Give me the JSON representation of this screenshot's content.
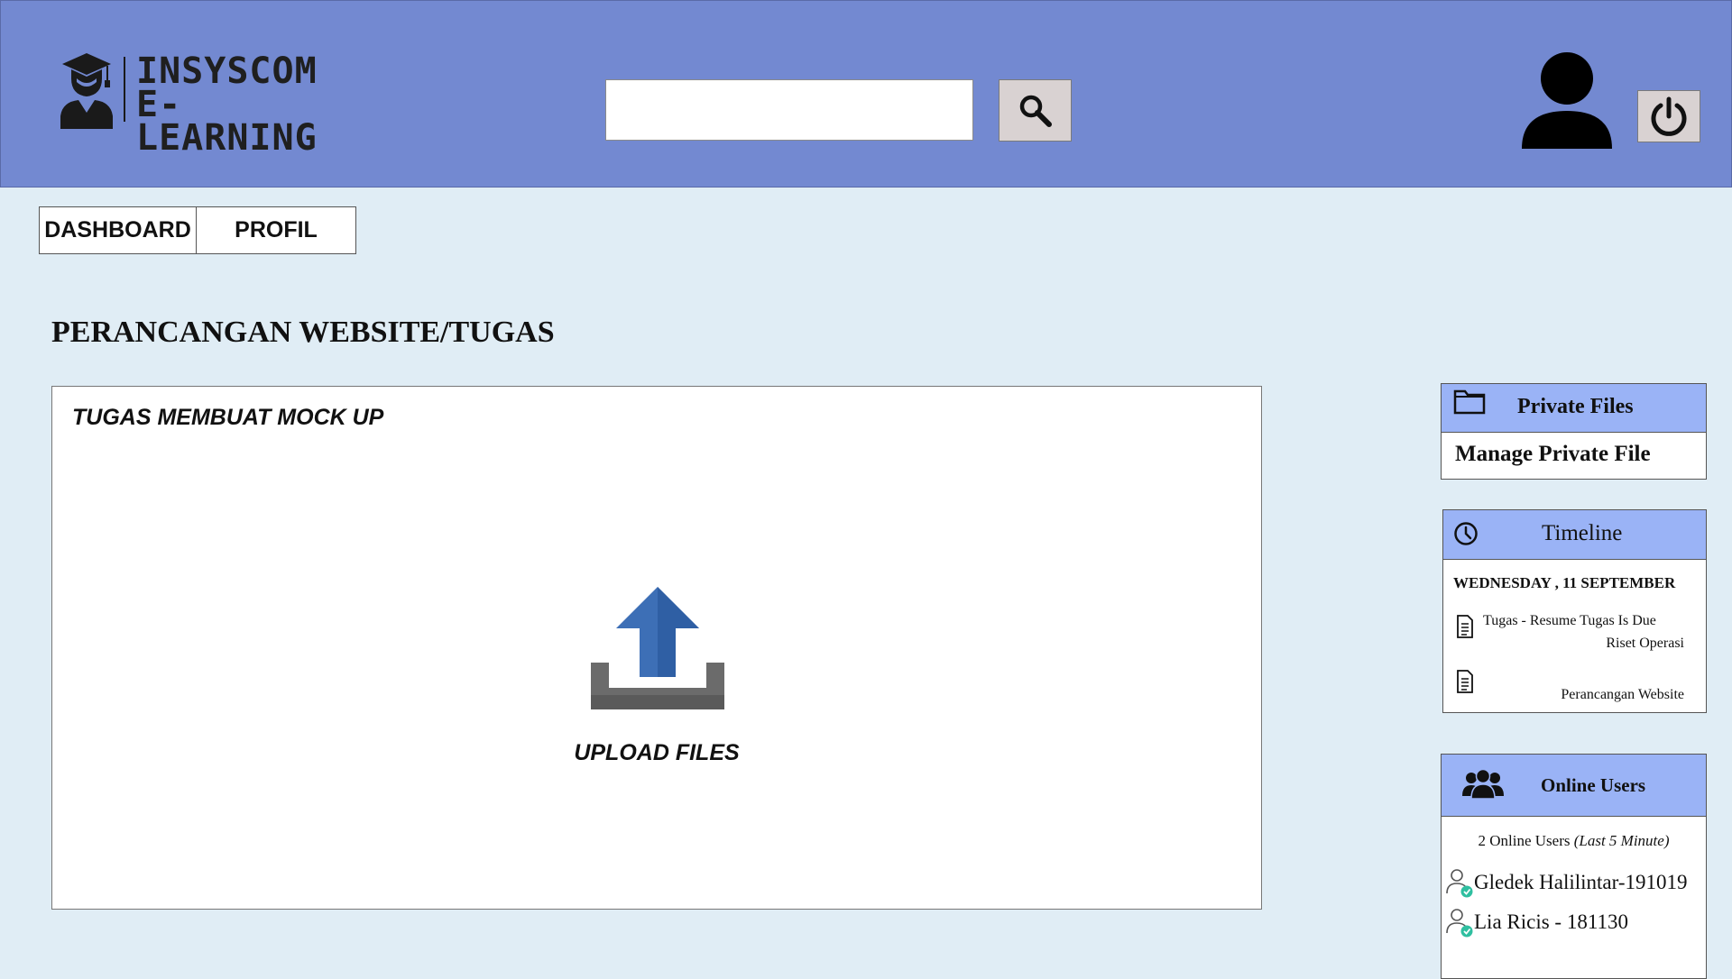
{
  "header": {
    "logo_line1": "INSYSCOM",
    "logo_line2": "E-LEARNING",
    "search_value": "",
    "search_icon": "search-icon",
    "avatar_icon": "user-avatar-icon",
    "power_icon": "power-icon"
  },
  "nav": {
    "dashboard": "DASHBOARD",
    "profil": "PROFIL"
  },
  "page": {
    "title": "PERANCANGAN WEBSITE/TUGAS"
  },
  "main": {
    "card_title": "TUGAS MEMBUAT MOCK UP",
    "upload_label": "UPLOAD FILES",
    "upload_icon": "upload-icon"
  },
  "private_files": {
    "title": "Private Files",
    "manage_link": "Manage Private File",
    "icon": "folder-icon"
  },
  "timeline": {
    "title": "Timeline",
    "icon": "clock-icon",
    "date": "WEDNESDAY , 11 SEPTEMBER",
    "events": [
      {
        "line1": "Tugas  - Resume Tugas Is Due",
        "line2": "Riset Operasi"
      },
      {
        "line1": "",
        "line2": "Perancangan Website"
      }
    ]
  },
  "online_users": {
    "title": "Online Users",
    "icon": "users-group-icon",
    "count_text": "2 Online Users",
    "count_note": "(Last 5 Minute)",
    "users": [
      {
        "name": "Gledek Halilintar-191019"
      },
      {
        "name": " Lia Ricis - 181130"
      }
    ]
  },
  "colors": {
    "header_bg": "#7389d1",
    "page_bg": "#e0edf5",
    "panel_head_bg": "#9ab3f6",
    "button_bg": "#d9d2d2",
    "upload_blue": "#3d6fb6",
    "online_check": "#2fbfa0"
  }
}
